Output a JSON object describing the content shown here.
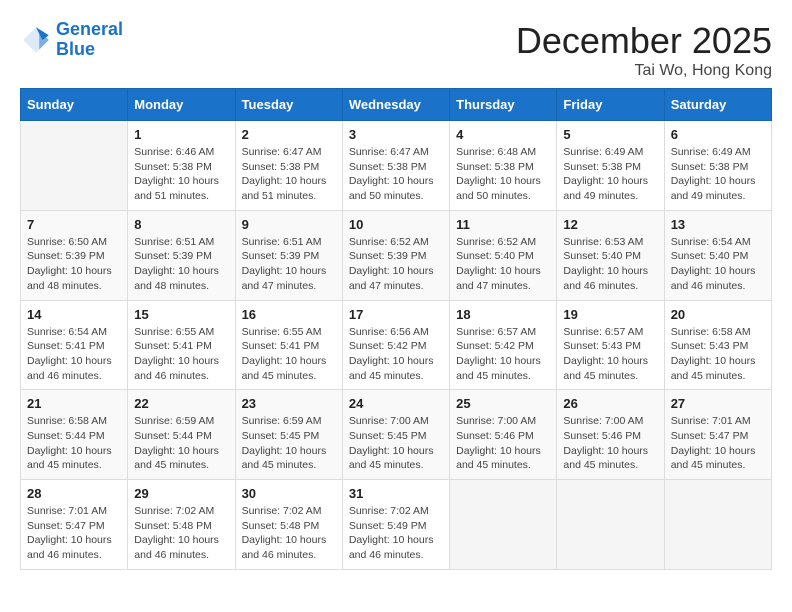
{
  "header": {
    "logo_line1": "General",
    "logo_line2": "Blue",
    "month_year": "December 2025",
    "location": "Tai Wo, Hong Kong"
  },
  "days_of_week": [
    "Sunday",
    "Monday",
    "Tuesday",
    "Wednesday",
    "Thursday",
    "Friday",
    "Saturday"
  ],
  "weeks": [
    [
      {
        "day": "",
        "info": ""
      },
      {
        "day": "1",
        "info": "Sunrise: 6:46 AM\nSunset: 5:38 PM\nDaylight: 10 hours\nand 51 minutes."
      },
      {
        "day": "2",
        "info": "Sunrise: 6:47 AM\nSunset: 5:38 PM\nDaylight: 10 hours\nand 51 minutes."
      },
      {
        "day": "3",
        "info": "Sunrise: 6:47 AM\nSunset: 5:38 PM\nDaylight: 10 hours\nand 50 minutes."
      },
      {
        "day": "4",
        "info": "Sunrise: 6:48 AM\nSunset: 5:38 PM\nDaylight: 10 hours\nand 50 minutes."
      },
      {
        "day": "5",
        "info": "Sunrise: 6:49 AM\nSunset: 5:38 PM\nDaylight: 10 hours\nand 49 minutes."
      },
      {
        "day": "6",
        "info": "Sunrise: 6:49 AM\nSunset: 5:38 PM\nDaylight: 10 hours\nand 49 minutes."
      }
    ],
    [
      {
        "day": "7",
        "info": "Sunrise: 6:50 AM\nSunset: 5:39 PM\nDaylight: 10 hours\nand 48 minutes."
      },
      {
        "day": "8",
        "info": "Sunrise: 6:51 AM\nSunset: 5:39 PM\nDaylight: 10 hours\nand 48 minutes."
      },
      {
        "day": "9",
        "info": "Sunrise: 6:51 AM\nSunset: 5:39 PM\nDaylight: 10 hours\nand 47 minutes."
      },
      {
        "day": "10",
        "info": "Sunrise: 6:52 AM\nSunset: 5:39 PM\nDaylight: 10 hours\nand 47 minutes."
      },
      {
        "day": "11",
        "info": "Sunrise: 6:52 AM\nSunset: 5:40 PM\nDaylight: 10 hours\nand 47 minutes."
      },
      {
        "day": "12",
        "info": "Sunrise: 6:53 AM\nSunset: 5:40 PM\nDaylight: 10 hours\nand 46 minutes."
      },
      {
        "day": "13",
        "info": "Sunrise: 6:54 AM\nSunset: 5:40 PM\nDaylight: 10 hours\nand 46 minutes."
      }
    ],
    [
      {
        "day": "14",
        "info": "Sunrise: 6:54 AM\nSunset: 5:41 PM\nDaylight: 10 hours\nand 46 minutes."
      },
      {
        "day": "15",
        "info": "Sunrise: 6:55 AM\nSunset: 5:41 PM\nDaylight: 10 hours\nand 46 minutes."
      },
      {
        "day": "16",
        "info": "Sunrise: 6:55 AM\nSunset: 5:41 PM\nDaylight: 10 hours\nand 45 minutes."
      },
      {
        "day": "17",
        "info": "Sunrise: 6:56 AM\nSunset: 5:42 PM\nDaylight: 10 hours\nand 45 minutes."
      },
      {
        "day": "18",
        "info": "Sunrise: 6:57 AM\nSunset: 5:42 PM\nDaylight: 10 hours\nand 45 minutes."
      },
      {
        "day": "19",
        "info": "Sunrise: 6:57 AM\nSunset: 5:43 PM\nDaylight: 10 hours\nand 45 minutes."
      },
      {
        "day": "20",
        "info": "Sunrise: 6:58 AM\nSunset: 5:43 PM\nDaylight: 10 hours\nand 45 minutes."
      }
    ],
    [
      {
        "day": "21",
        "info": "Sunrise: 6:58 AM\nSunset: 5:44 PM\nDaylight: 10 hours\nand 45 minutes."
      },
      {
        "day": "22",
        "info": "Sunrise: 6:59 AM\nSunset: 5:44 PM\nDaylight: 10 hours\nand 45 minutes."
      },
      {
        "day": "23",
        "info": "Sunrise: 6:59 AM\nSunset: 5:45 PM\nDaylight: 10 hours\nand 45 minutes."
      },
      {
        "day": "24",
        "info": "Sunrise: 7:00 AM\nSunset: 5:45 PM\nDaylight: 10 hours\nand 45 minutes."
      },
      {
        "day": "25",
        "info": "Sunrise: 7:00 AM\nSunset: 5:46 PM\nDaylight: 10 hours\nand 45 minutes."
      },
      {
        "day": "26",
        "info": "Sunrise: 7:00 AM\nSunset: 5:46 PM\nDaylight: 10 hours\nand 45 minutes."
      },
      {
        "day": "27",
        "info": "Sunrise: 7:01 AM\nSunset: 5:47 PM\nDaylight: 10 hours\nand 45 minutes."
      }
    ],
    [
      {
        "day": "28",
        "info": "Sunrise: 7:01 AM\nSunset: 5:47 PM\nDaylight: 10 hours\nand 46 minutes."
      },
      {
        "day": "29",
        "info": "Sunrise: 7:02 AM\nSunset: 5:48 PM\nDaylight: 10 hours\nand 46 minutes."
      },
      {
        "day": "30",
        "info": "Sunrise: 7:02 AM\nSunset: 5:48 PM\nDaylight: 10 hours\nand 46 minutes."
      },
      {
        "day": "31",
        "info": "Sunrise: 7:02 AM\nSunset: 5:49 PM\nDaylight: 10 hours\nand 46 minutes."
      },
      {
        "day": "",
        "info": ""
      },
      {
        "day": "",
        "info": ""
      },
      {
        "day": "",
        "info": ""
      }
    ]
  ]
}
